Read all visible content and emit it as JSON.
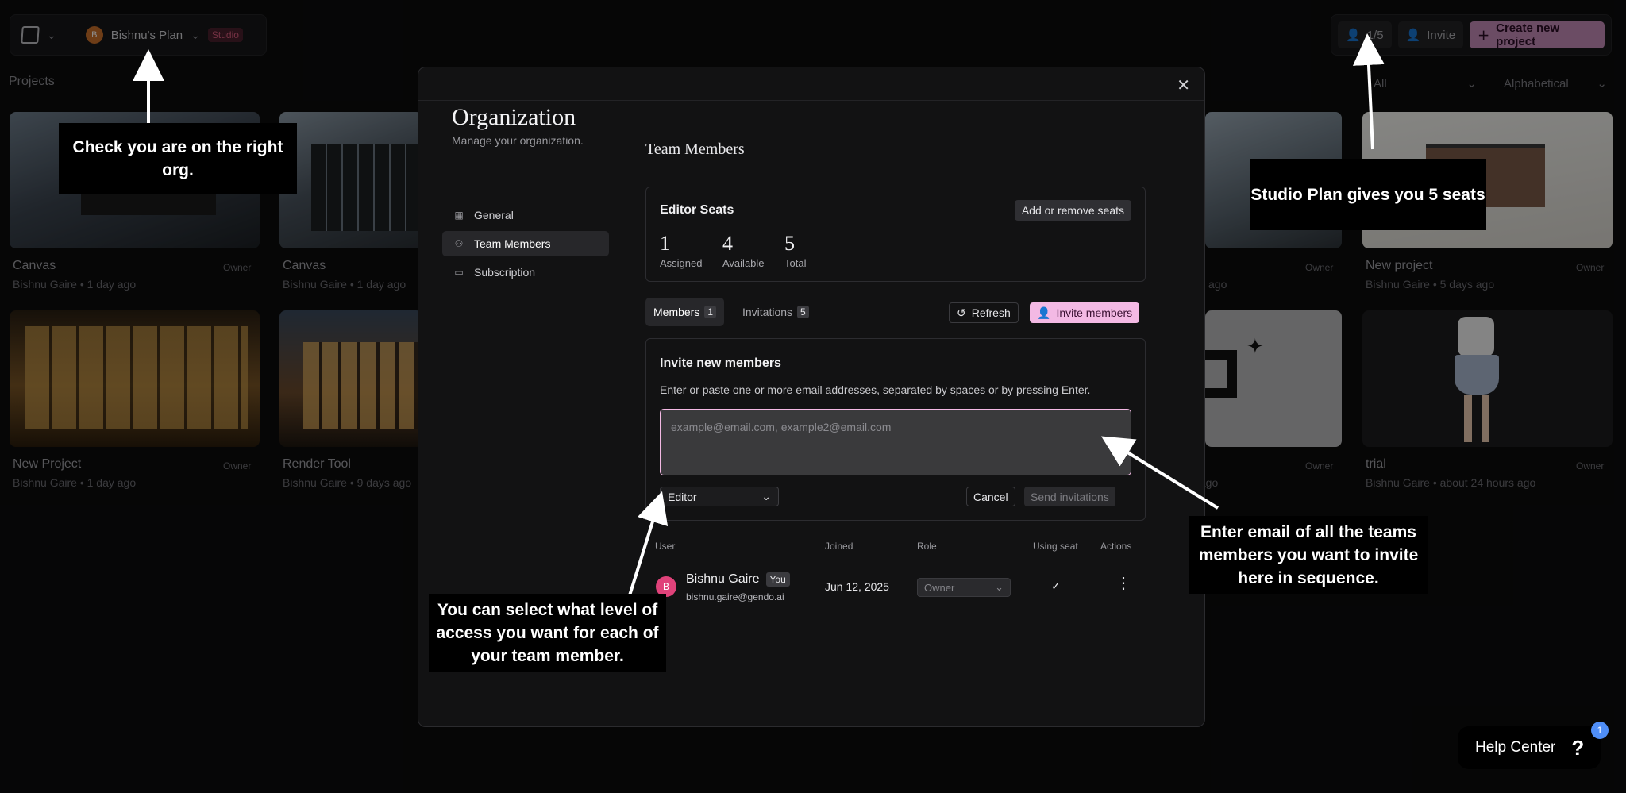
{
  "topbar": {
    "org_initial": "B",
    "org_name": "Bishnu's Plan",
    "plan_badge": "Studio",
    "seat_count": "1/5",
    "invite_label": "Invite",
    "create_label": "Create new project"
  },
  "projects": {
    "title": "Projects",
    "filter_all": "All",
    "sort": "Alphabetical",
    "cards": [
      {
        "title": "Canvas",
        "meta": "Bishnu Gaire • 1 day ago",
        "role": "Owner"
      },
      {
        "title": "Canvas",
        "meta": "Bishnu Gaire • 1 day ago",
        "role": "Owner"
      },
      {
        "title": "",
        "meta": "ago",
        "role": "Owner"
      },
      {
        "title": "New project",
        "meta": "Bishnu Gaire • 5 days ago",
        "role": "Owner"
      },
      {
        "title": "New Project",
        "meta": "Bishnu Gaire • 1 day ago",
        "role": "Owner"
      },
      {
        "title": "Render Tool",
        "meta": "Bishnu Gaire • 9 days ago",
        "role": ""
      },
      {
        "title": "",
        "meta": "s ago",
        "role": "Owner"
      },
      {
        "title": "trial",
        "meta": "Bishnu Gaire • about 24 hours ago",
        "role": "Owner"
      }
    ]
  },
  "modal": {
    "org_title": "Organization",
    "org_subtitle": "Manage your organization.",
    "nav": [
      {
        "label": "General",
        "icon": "building-icon"
      },
      {
        "label": "Team Members",
        "icon": "users-icon"
      },
      {
        "label": "Subscription",
        "icon": "card-icon"
      }
    ],
    "section_title": "Team Members",
    "seats": {
      "title": "Editor Seats",
      "button": "Add or remove seats",
      "assigned_value": "1",
      "assigned_label": "Assigned",
      "available_value": "4",
      "available_label": "Available",
      "total_value": "5",
      "total_label": "Total"
    },
    "tabs": {
      "members_label": "Members",
      "members_count": "1",
      "invitations_label": "Invitations",
      "invitations_count": "5"
    },
    "refresh_label": "Refresh",
    "invite_members_label": "Invite members",
    "invite": {
      "title": "Invite new members",
      "description": "Enter or paste one or more email addresses, separated by spaces or by pressing Enter.",
      "placeholder": "example@email.com, example2@email.com",
      "role": "Editor",
      "cancel": "Cancel",
      "send": "Send invitations"
    },
    "table": {
      "headers": [
        "User",
        "Joined",
        "Role",
        "Using seat",
        "Actions"
      ],
      "rows": [
        {
          "initial": "B",
          "name": "Bishnu Gaire",
          "badge": "You",
          "email": "bishnu.gaire@gendo.ai",
          "joined": "Jun 12, 2025",
          "role": "Owner",
          "seat": "✓"
        }
      ]
    }
  },
  "callouts": {
    "org": "Check you are on the right org.",
    "seats": "Studio Plan gives you 5 seats",
    "email": "Enter email of all the teams members you want to invite here in sequence.",
    "access": "You can select what level of access you want for each of your team member."
  },
  "help": {
    "label": "Help Center",
    "badge": "1"
  }
}
